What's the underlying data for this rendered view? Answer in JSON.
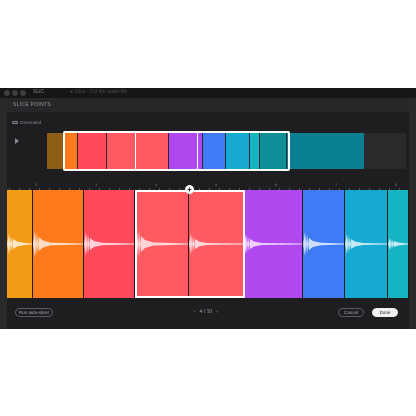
{
  "window": {
    "title": "SLIC",
    "breadcrumb": "● Slice · Cut the audio file",
    "panel_title": "SLICE POINTS",
    "generated_label": "Generated"
  },
  "overview_segments": [
    {
      "color": "#f39b17",
      "dim": false
    },
    {
      "color": "#ff7a1a",
      "dim": false
    },
    {
      "color": "#ff4a5c",
      "dim": false
    },
    {
      "color": "#ff5a62",
      "dim": false
    },
    {
      "color": "#b148ef",
      "dim": false
    },
    {
      "color": "#3f7bf5",
      "dim": false
    },
    {
      "color": "#16a9d2",
      "dim": false
    },
    {
      "color": "#16b3c2",
      "dim": false
    },
    {
      "color": "#0e8f98",
      "dim": true
    },
    {
      "color": "#0c8093",
      "dim": true
    }
  ],
  "ruler": {
    "labels": [
      "2",
      "3",
      "4",
      "5",
      "6",
      "7",
      "8"
    ]
  },
  "main_segments": [
    {
      "color": "#f39b17"
    },
    {
      "color": "#ff7a1a"
    },
    {
      "color": "#ff4a5c"
    },
    {
      "color": "#ff5a62",
      "selected": true
    },
    {
      "color": "#ff5a62",
      "selected": true
    },
    {
      "color": "#b148ef"
    },
    {
      "color": "#3f7bf5"
    },
    {
      "color": "#16a9d2"
    },
    {
      "color": "#16b3c2"
    }
  ],
  "footer": {
    "run_auto_slicer": "Run auto-slicer",
    "pager_text": "4 / 10",
    "prev": "‹",
    "next": "›",
    "cancel": "Cancel",
    "done": "Done"
  },
  "add_slice_glyph": "+"
}
